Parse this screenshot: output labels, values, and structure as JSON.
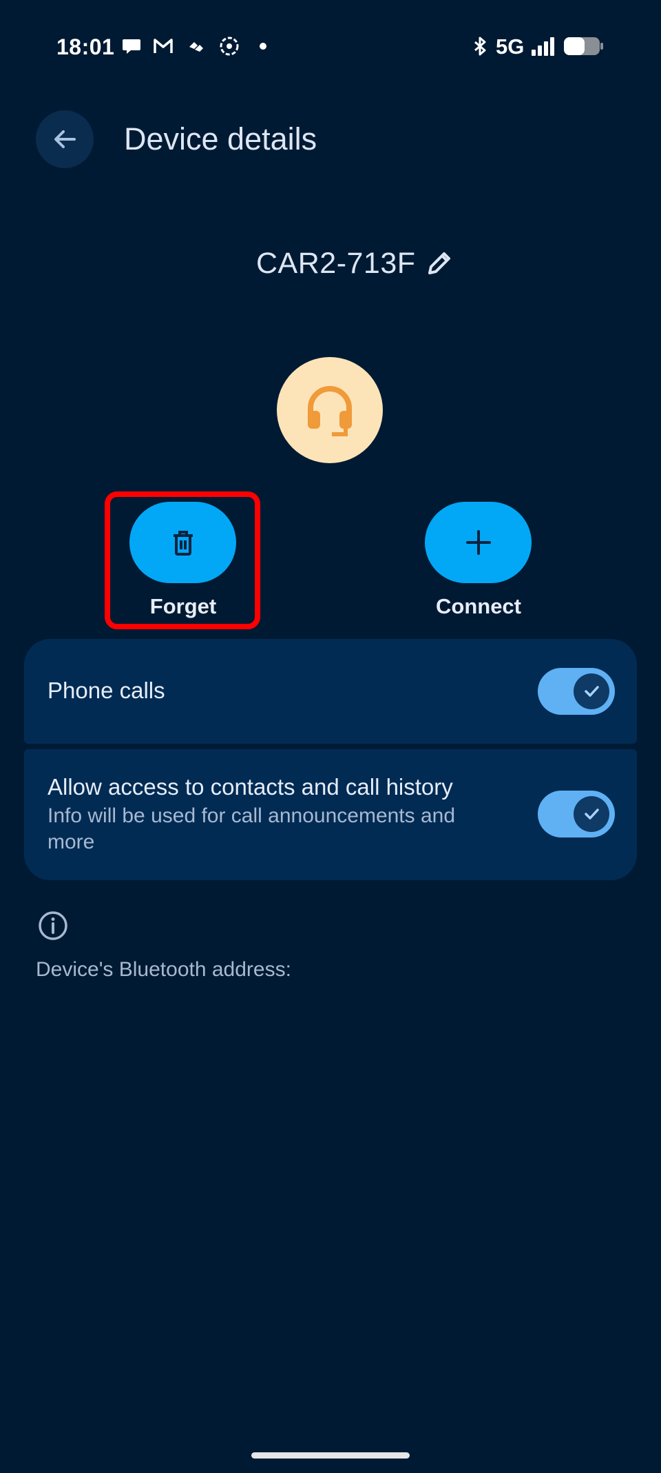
{
  "status_bar": {
    "time": "18:01",
    "network": "5G",
    "left_icons": [
      "chat-icon",
      "gmail-icon",
      "health-icon",
      "pinwheel-icon",
      "dot-icon"
    ],
    "right_icons": [
      "bluetooth-icon",
      "signal-icon",
      "battery-icon"
    ]
  },
  "header": {
    "title": "Device details",
    "back_icon": "arrow-left-icon"
  },
  "device": {
    "name": "CAR2-713F",
    "edit_icon": "pencil-icon",
    "avatar_icon": "headset-icon"
  },
  "actions": {
    "forget_label": "Forget",
    "connect_label": "Connect"
  },
  "settings": {
    "phone_calls": {
      "label": "Phone calls",
      "enabled": true
    },
    "contacts": {
      "label": "Allow access to contacts and call history",
      "subtitle_line1": "Info will be used for call announcements and",
      "subtitle_line2": "more",
      "enabled": true
    }
  },
  "info": {
    "address_label": "Device's Bluetooth address: "
  },
  "colors": {
    "background": "#011a33",
    "card": "#022b54",
    "accent_button": "#02a8f5",
    "toggle_track": "#5fb1f4",
    "highlight": "#ff0000",
    "avatar_bg": "#fde4b8",
    "avatar_icon": "#f09a3a"
  }
}
